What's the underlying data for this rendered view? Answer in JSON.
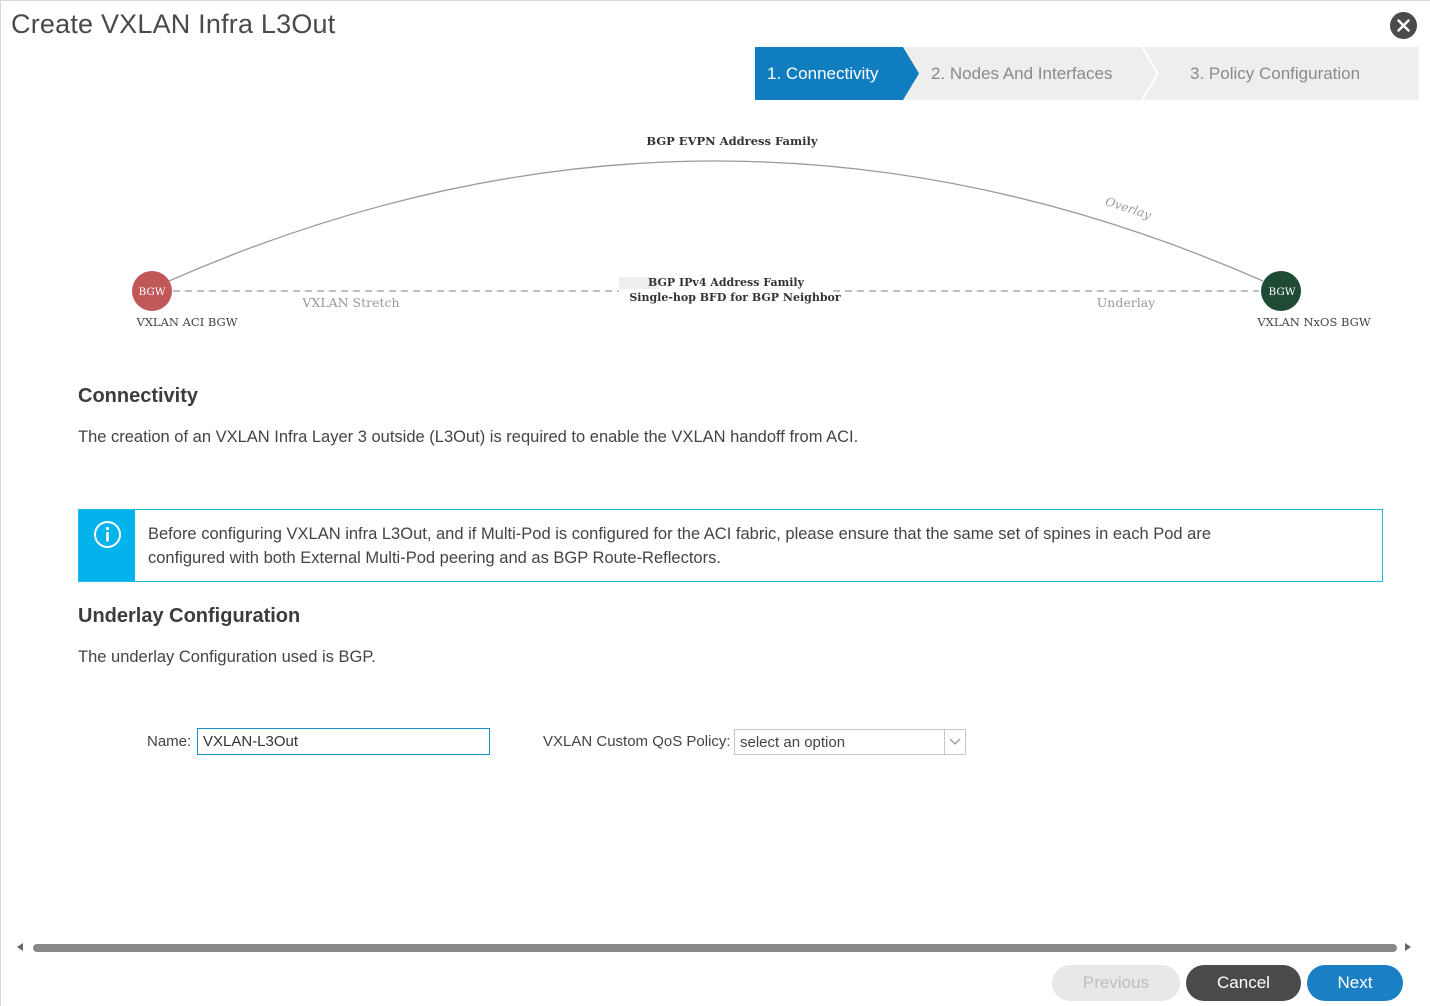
{
  "dialog": {
    "title": "Create VXLAN Infra L3Out"
  },
  "wizard": {
    "steps": [
      {
        "label": "1. Connectivity",
        "active": true
      },
      {
        "label": "2. Nodes And Interfaces",
        "active": false
      },
      {
        "label": "3. Policy Configuration",
        "active": false
      }
    ],
    "active_color": "#0f7dbf",
    "inactive_color": "#eeeeee"
  },
  "diagram": {
    "left_node": {
      "badge": "BGW",
      "label": "VXLAN ACI BGW",
      "color": "#c0585a"
    },
    "right_node": {
      "badge": "BGW",
      "label": "VXLAN NxOS BGW",
      "color": "#1f4a33"
    },
    "overlay_title": "BGP EVPN Address Family",
    "overlay_label": "Overlay",
    "stretch_label": "VXLAN Stretch",
    "underlay_line1": "BGP IPv4 Address Family",
    "underlay_line2": "Single-hop BFD for BGP Neighbor",
    "underlay_label": "Underlay"
  },
  "connectivity": {
    "title": "Connectivity",
    "description": "The creation of an VXLAN Infra Layer 3 outside (L3Out) is required to enable the VXLAN handoff from ACI."
  },
  "info": {
    "line1": "Before configuring VXLAN infra L3Out, and if Multi-Pod is configured for the ACI fabric, please ensure that the same set of spines in each Pod are",
    "line2": "configured with both External Multi-Pod peering and as BGP Route-Reflectors.",
    "accent_color": "#03b4ec"
  },
  "underlay": {
    "title": "Underlay Configuration",
    "description": "The underlay Configuration used is BGP."
  },
  "form": {
    "name_label": "Name:",
    "name_value": "VXLAN-L3Out",
    "qos_label": "VXLAN Custom QoS Policy:",
    "qos_placeholder": "select an option"
  },
  "footer": {
    "previous_label": "Previous",
    "cancel_label": "Cancel",
    "next_label": "Next"
  }
}
